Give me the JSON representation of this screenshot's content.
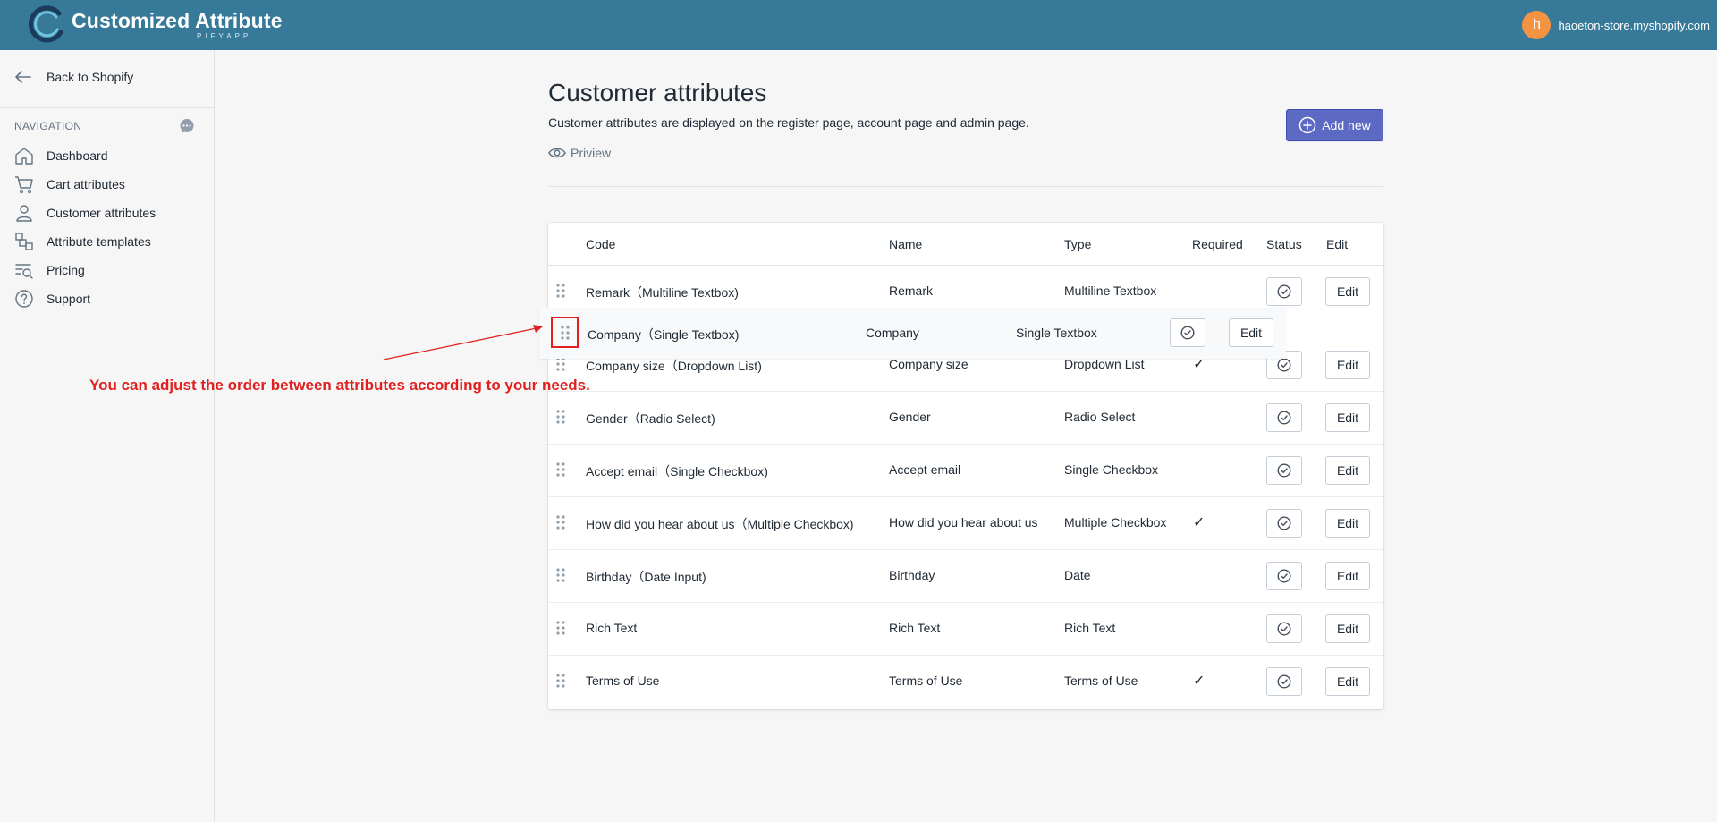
{
  "brand": {
    "title": "Customized Attribute",
    "subtitle": "PIFYAPP"
  },
  "user": {
    "avatar_initial": "h",
    "store": "haoeton-store.myshopify.com",
    "avatar_color": "#f49342"
  },
  "colors": {
    "topbar": "#367999",
    "primary": "#5c6ac4",
    "annotation": "#e0211f"
  },
  "sidebar": {
    "back_label": "Back to Shopify",
    "nav_label": "NAVIGATION",
    "items": [
      {
        "label": "Dashboard",
        "icon": "home-icon"
      },
      {
        "label": "Cart attributes",
        "icon": "cart-icon"
      },
      {
        "label": "Customer attributes",
        "icon": "person-icon"
      },
      {
        "label": "Attribute templates",
        "icon": "templates-icon"
      },
      {
        "label": "Pricing",
        "icon": "pricing-icon"
      },
      {
        "label": "Support",
        "icon": "question-icon"
      }
    ]
  },
  "page": {
    "title": "Customer attributes",
    "description": "Customer attributes are displayed on the register page, account page and admin page.",
    "preview_label": "Priview",
    "add_label": "Add new"
  },
  "table": {
    "headers": {
      "code": "Code",
      "name": "Name",
      "type": "Type",
      "required": "Required",
      "status": "Status",
      "edit": "Edit"
    },
    "rows": [
      {
        "code": "Remark（Multiline Textbox)",
        "name": "Remark",
        "type": "Multiline Textbox",
        "required": "",
        "edit": "Edit"
      },
      {
        "code": "Company size（Dropdown List)",
        "name": "Company size",
        "type": "Dropdown List",
        "required": "✓",
        "edit": "Edit"
      },
      {
        "code": "Gender（Radio Select)",
        "name": "Gender",
        "type": "Radio Select",
        "required": "",
        "edit": "Edit"
      },
      {
        "code": "Accept email（Single Checkbox)",
        "name": "Accept email",
        "type": "Single Checkbox",
        "required": "",
        "edit": "Edit"
      },
      {
        "code": "How did you hear about us（Multiple Checkbox)",
        "name": "How did you hear about us",
        "type": "Multiple Checkbox",
        "required": "✓",
        "edit": "Edit"
      },
      {
        "code": "Birthday（Date Input)",
        "name": "Birthday",
        "type": "Date",
        "required": "",
        "edit": "Edit"
      },
      {
        "code": "Rich Text",
        "name": "Rich Text",
        "type": "Rich Text",
        "required": "",
        "edit": "Edit"
      },
      {
        "code": "Terms of Use",
        "name": "Terms of Use",
        "type": "Terms of Use",
        "required": "✓",
        "edit": "Edit"
      }
    ],
    "dragging_row": {
      "code": "Company（Single Textbox)",
      "name": "Company",
      "type": "Single Textbox",
      "edit": "Edit"
    }
  },
  "annotation": {
    "text": "You can adjust the order between attributes according to your needs."
  }
}
